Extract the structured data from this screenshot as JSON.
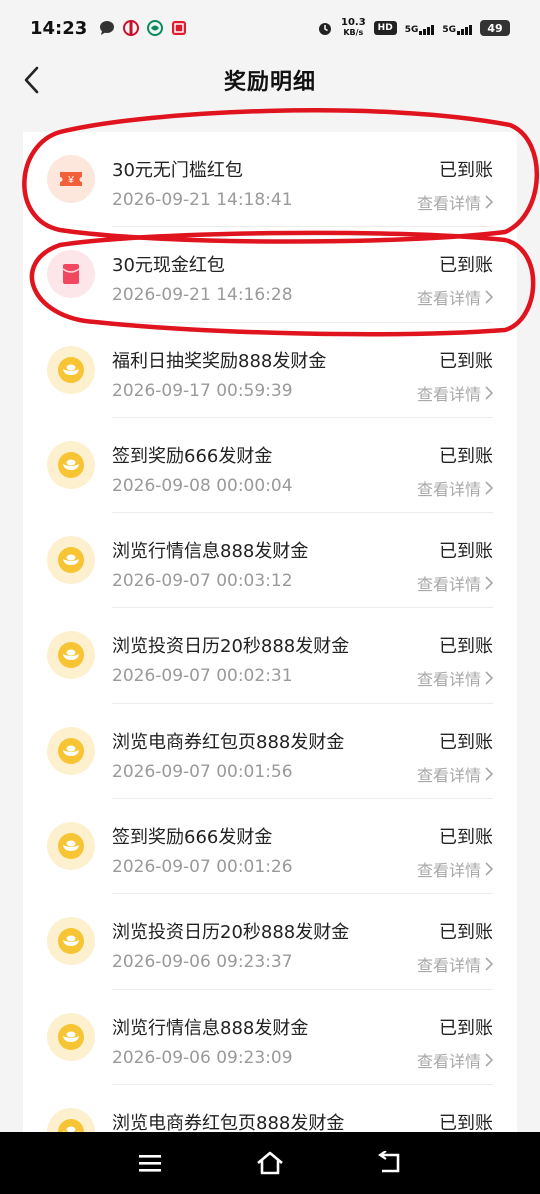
{
  "status_bar": {
    "time": "14:23",
    "net_speed_value": "10.3",
    "net_speed_unit": "KB/s",
    "hd_label": "HD",
    "sim1_label": "5G",
    "sim2_label": "5G",
    "battery": "49"
  },
  "header": {
    "title": "奖励明细"
  },
  "list": {
    "status_label": "已到账",
    "link_label": "查看详情",
    "items": [
      {
        "title": "30元无门槛红包",
        "date": "2026-09-21 14:18:41",
        "icon": "ticket-icon"
      },
      {
        "title": "30元现金红包",
        "date": "2026-09-21 14:16:28",
        "icon": "red-envelope-icon"
      },
      {
        "title": "福利日抽奖奖励888发财金",
        "date": "2026-09-17 00:59:39",
        "icon": "gold-ingot-icon"
      },
      {
        "title": "签到奖励666发财金",
        "date": "2026-09-08 00:00:04",
        "icon": "gold-ingot-icon"
      },
      {
        "title": "浏览行情信息888发财金",
        "date": "2026-09-07 00:03:12",
        "icon": "gold-ingot-icon"
      },
      {
        "title": "浏览投资日历20秒888发财金",
        "date": "2026-09-07 00:02:31",
        "icon": "gold-ingot-icon"
      },
      {
        "title": "浏览电商券红包页888发财金",
        "date": "2026-09-07 00:01:56",
        "icon": "gold-ingot-icon"
      },
      {
        "title": "签到奖励666发财金",
        "date": "2026-09-07 00:01:26",
        "icon": "gold-ingot-icon"
      },
      {
        "title": "浏览投资日历20秒888发财金",
        "date": "2026-09-06 09:23:37",
        "icon": "gold-ingot-icon"
      },
      {
        "title": "浏览行情信息888发财金",
        "date": "2026-09-06 09:23:09",
        "icon": "gold-ingot-icon"
      },
      {
        "title": "浏览电商券红包页888发财金",
        "date": "",
        "icon": "gold-ingot-icon"
      }
    ]
  },
  "colors": {
    "annotation": "#e0141e",
    "coin": "#f7c433",
    "envelope": "#f2485f",
    "ticket": "#f2603a"
  }
}
